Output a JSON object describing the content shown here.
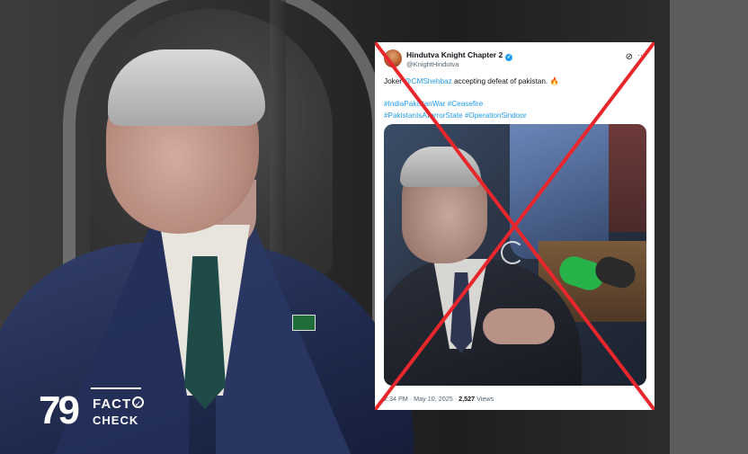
{
  "tweet": {
    "display_name": "Hindutva Knight Chapter 2",
    "handle": "@KnightHindutva",
    "text_prefix": "Joker ",
    "mention": "@CMShehbaz",
    "text_suffix": " accepting defeat of pakistan. ",
    "emoji": "🔥",
    "hashtags_line1": "#IndiaPakistanWar #Ceasefire",
    "hashtags_line2": "#PakistanIsATerrorState #OperationSindoor",
    "timestamp": "2:34 PM · May 10, 2025 · ",
    "views_count": "2,527",
    "views_label": " Views"
  },
  "logo": {
    "number": "79",
    "line1": "FACT",
    "line2": "CHECK"
  },
  "colors": {
    "cross": "#e8262c",
    "link": "#1d9bf0",
    "suit": "#1f2a4d",
    "mic": "#27b34a"
  },
  "icons": [
    "verified-badge-icon",
    "grok-icon",
    "more-options-icon",
    "media-loading-spinner-icon",
    "false-cross-icon",
    "checkmark-icon"
  ]
}
